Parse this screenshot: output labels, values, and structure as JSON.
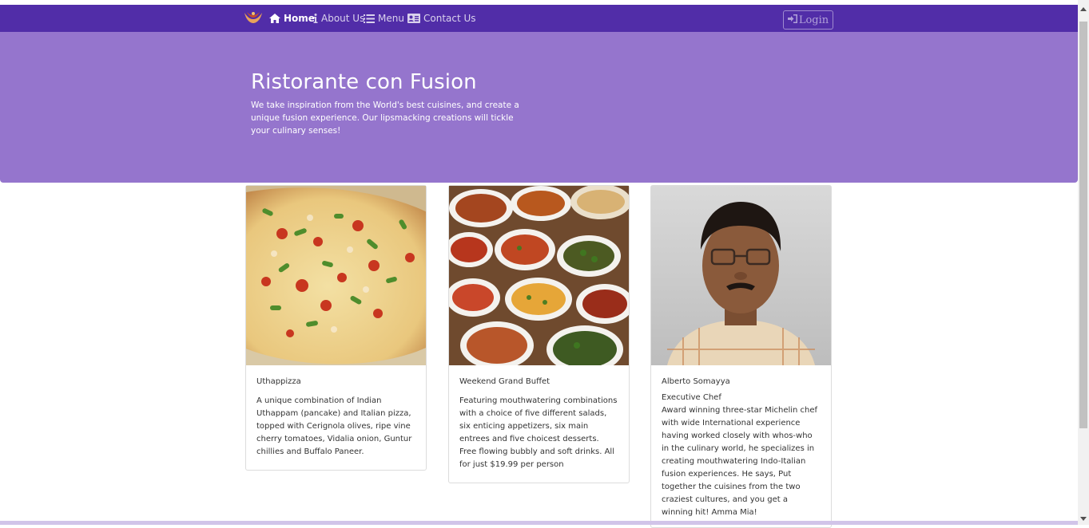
{
  "navbar": {
    "brand_icon": "logo-icon",
    "items": [
      {
        "label": "Home",
        "icon": "home-icon",
        "active": true
      },
      {
        "label": "About Us",
        "icon": "info-icon",
        "active": false
      },
      {
        "label": "Menu",
        "icon": "list-icon",
        "active": false
      },
      {
        "label": "Contact Us",
        "icon": "address-card-icon",
        "active": false
      }
    ],
    "login_label": "Login",
    "login_icon": "sign-in-icon"
  },
  "jumbotron": {
    "title": "Ristorante con Fusion",
    "text": "We take inspiration from the World's best cuisines, and create a unique fusion experience. Our lipsmacking creations will tickle your culinary senses!"
  },
  "cards": [
    {
      "image": "pizza-photo",
      "title": "Uthappizza",
      "text": "A unique combination of Indian Uthappam (pancake) and Italian pizza, topped with Cerignola olives, ripe vine cherry tomatoes, Vidalia onion, Guntur chillies and Buffalo Paneer."
    },
    {
      "image": "buffet-photo",
      "title": "Weekend Grand Buffet",
      "text": "Featuring mouthwatering combinations with a choice of five different salads, six enticing appetizers, six main entrees and five choicest desserts. Free flowing bubbly and soft drinks. All for just $19.99 per person"
    },
    {
      "image": "chef-photo",
      "title": "Alberto Somayya",
      "subtitle": "Executive Chef",
      "text": "Award winning three-star Michelin chef with wide International experience having worked closely with whos-who in the culinary world, he specializes in creating mouthwatering Indo-Italian fusion experiences. He says, Put together the cuisines from the two craziest cultures, and you get a winning hit! Amma Mia!"
    }
  ],
  "colors": {
    "navbar": "#512da8",
    "jumbotron": "#9575cd",
    "footer_band": "#d1c4e9"
  }
}
